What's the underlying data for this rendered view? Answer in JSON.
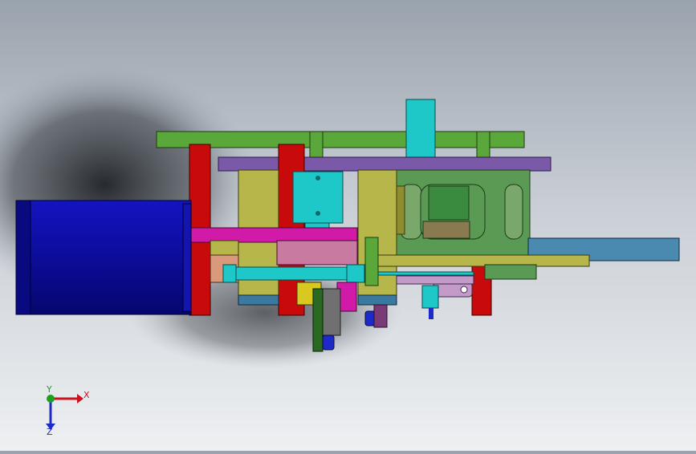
{
  "viewport": {
    "name": "cad-graphics-area",
    "colors": {
      "background_top": "#9aa3ad",
      "background_bottom": "#eef0f2",
      "shadow": "#2a2e33",
      "motor_blue": "#1010b0",
      "motor_blue_dark": "#0a0a80",
      "frame_green": "#5aa83a",
      "plate_purple": "#7a5aa8",
      "post_red": "#c80a0a",
      "block_olive": "#b6b64a",
      "block_olive_dark": "#8e8e30",
      "cylinder_cyan": "#1ec8c8",
      "slot_green": "#5a9a55",
      "magenta": "#d21aa8",
      "salmon": "#d89a7a",
      "rail_steel": "#3a7aa0",
      "lilac": "#c49ac8",
      "dark_green": "#2a6a20"
    }
  },
  "triad": {
    "x_label": "X",
    "y_label": "Y",
    "z_label": "Z",
    "x_color": "#c8141e",
    "y_color": "#1ea01e",
    "z_color": "#1e2ac8"
  }
}
